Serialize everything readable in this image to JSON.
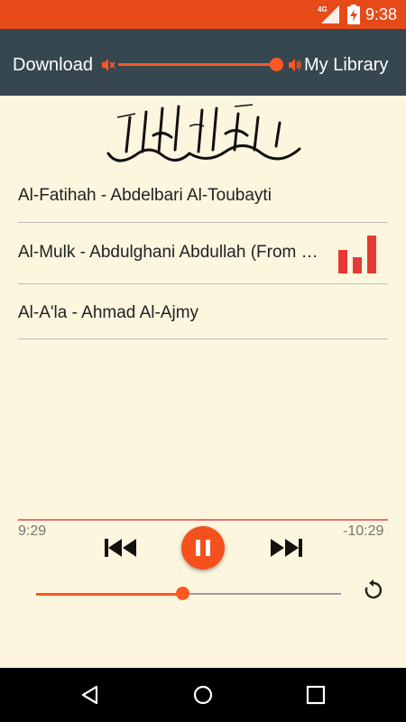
{
  "status_bar": {
    "network": "4G",
    "time": "9:38"
  },
  "toolbar": {
    "download_label": "Download",
    "library_label": "My Library",
    "volume_level": 0.96
  },
  "header": {
    "calligraphy_icon": "bismillah-calligraphy"
  },
  "playlist": [
    {
      "label": "Al-Fatihah - Abdelbari Al-Toubayti"
    },
    {
      "label": "Al-Mulk - Abdulghani Abdullah (From Shaykh Abdulghani Abdullah's album)",
      "playing": true
    },
    {
      "label": "Al-A'la - Ahmad Al-Ajmy"
    }
  ],
  "player": {
    "elapsed": "9:29",
    "remaining": "-10:29",
    "progress": 0.48
  },
  "icons": {
    "accent": "#ff5722",
    "toolbar_bg": "#37474f",
    "status_bg": "#e64a19",
    "page_bg": "#fdf6df",
    "equalizer": "#e53935"
  }
}
